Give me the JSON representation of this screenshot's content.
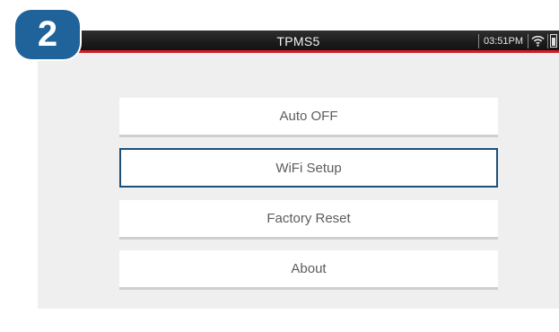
{
  "badge": {
    "number": "2"
  },
  "status_bar": {
    "title": "TPMS5",
    "time": "03:51PM",
    "icons": [
      "wifi-icon",
      "battery-icon"
    ]
  },
  "menu": {
    "items": [
      {
        "label": "Auto OFF",
        "selected": false
      },
      {
        "label": "WiFi Setup",
        "selected": true
      },
      {
        "label": "Factory Reset",
        "selected": false
      },
      {
        "label": "About",
        "selected": false
      }
    ]
  },
  "colors": {
    "accent_red": "#d21f26",
    "selection_border": "#1f4f78",
    "badge_blue": "#20629a",
    "screen_bg": "#efefef"
  }
}
